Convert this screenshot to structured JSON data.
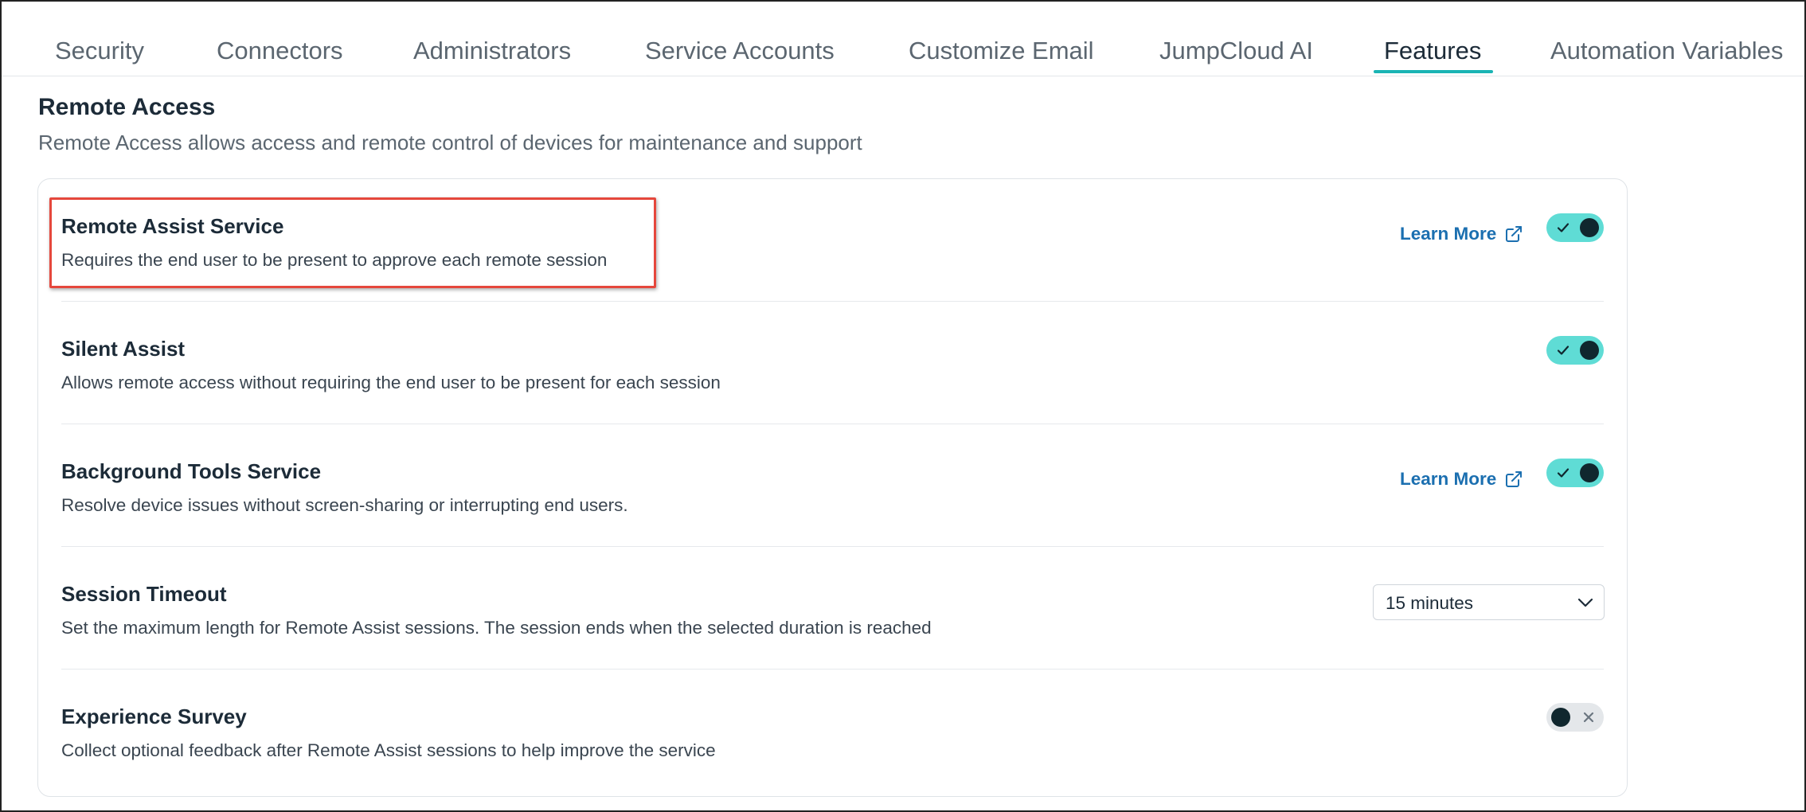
{
  "tabs": [
    {
      "label": "Security",
      "active": false
    },
    {
      "label": "Connectors",
      "active": false
    },
    {
      "label": "Administrators",
      "active": false
    },
    {
      "label": "Service Accounts",
      "active": false
    },
    {
      "label": "Customize Email",
      "active": false
    },
    {
      "label": "JumpCloud AI",
      "active": false
    },
    {
      "label": "Features",
      "active": true
    },
    {
      "label": "Automation Variables",
      "active": false
    }
  ],
  "section": {
    "title": "Remote Access",
    "description": "Remote Access allows access and remote control of devices for maintenance and support"
  },
  "settings": [
    {
      "title": "Remote Assist Service",
      "description": "Requires the end user to be present to approve each remote session",
      "learn_more": "Learn More",
      "enabled": true,
      "highlighted": true
    },
    {
      "title": "Silent Assist",
      "description": "Allows remote access without requiring the end user to be present for each session",
      "enabled": true
    },
    {
      "title": "Background Tools Service",
      "description": "Resolve device issues without screen-sharing or interrupting end users.",
      "learn_more": "Learn More",
      "enabled": true
    },
    {
      "title": "Session Timeout",
      "description": "Set the maximum length for Remote Assist sessions. The session ends when the selected duration is reached",
      "select_value": "15 minutes"
    },
    {
      "title": "Experience Survey",
      "description": "Collect optional feedback after Remote Assist sessions to help improve the service",
      "enabled": false
    }
  ],
  "colors": {
    "accent": "#1ab4b4",
    "toggle_on": "#5fdcd5",
    "link": "#1b6fb0",
    "highlight": "#e5473c"
  },
  "icons": {
    "learn_more": "external-link-icon",
    "toggle_on": "check-icon",
    "toggle_off": "x-icon",
    "select": "chevron-down-icon"
  }
}
